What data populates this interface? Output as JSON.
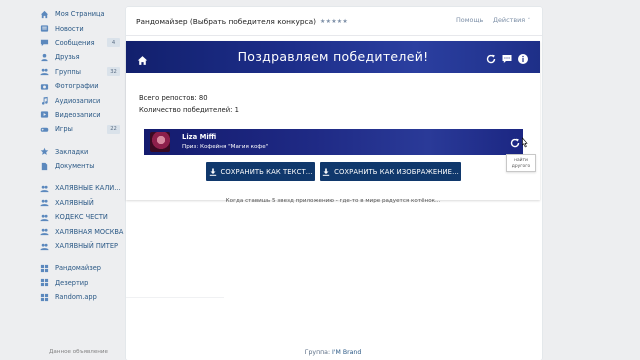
{
  "sidebar": {
    "items": [
      {
        "label": "Моя Страница",
        "icon": "home-icon"
      },
      {
        "label": "Новости",
        "icon": "news-icon"
      },
      {
        "label": "Сообщения",
        "icon": "messages-icon",
        "count": "4"
      },
      {
        "label": "Друзья",
        "icon": "friends-icon"
      },
      {
        "label": "Группы",
        "icon": "groups-icon",
        "count": "32"
      },
      {
        "label": "Фотографии",
        "icon": "photos-icon"
      },
      {
        "label": "Аудиозаписи",
        "icon": "audio-icon"
      },
      {
        "label": "Видеозаписи",
        "icon": "video-icon"
      },
      {
        "label": "Игры",
        "icon": "games-icon",
        "count": "22"
      }
    ],
    "items2": [
      {
        "label": "Закладки",
        "icon": "bookmarks-icon"
      },
      {
        "label": "Документы",
        "icon": "documents-icon"
      }
    ],
    "groups": [
      {
        "label": "ХАЛЯВНЫЕ КАЛИ..."
      },
      {
        "label": "ХАЛЯВНЫЙ"
      },
      {
        "label": "КОДЕКС ЧЕСТИ"
      },
      {
        "label": "ХАЛЯВНАЯ МОСКВА"
      },
      {
        "label": "ХАЛЯВНЫЙ ПИТЕР"
      }
    ],
    "apps": [
      {
        "label": "Рандомайзер"
      },
      {
        "label": "Дезертир"
      },
      {
        "label": "Random.app"
      }
    ],
    "ad_label": "Данное объявление"
  },
  "header": {
    "title": "Рандомайзер (Выбрать победителя конкурса)",
    "stars": "★★★★★",
    "help": "Помощь",
    "actions": "Действия"
  },
  "app": {
    "banner_title": "Поздравляем победителей!",
    "reposts": "Всего репостов: 80",
    "winners_count": "Количество победителей: 1",
    "winner": {
      "name": "Liza Miffi",
      "prize": "Приз: Кофейня \"Магия кофе\""
    },
    "tooltip": "найти другого",
    "save_text_button": "СОХРАНИТЬ КАК ТЕКСТ...",
    "save_image_button": "СОХРАНИТЬ КАК ИЗОБРАЖЕНИЕ..."
  },
  "tagline": "Когда ставишь 5 звезд приложению - где-то в мире радуется котёнок...",
  "footer": {
    "prefix": "Группа: ",
    "link": "I'M Brand"
  },
  "colors": {
    "banner": "#1d2e8a",
    "button": "#10386c",
    "link": "#2a5885",
    "background": "#edeef0"
  }
}
